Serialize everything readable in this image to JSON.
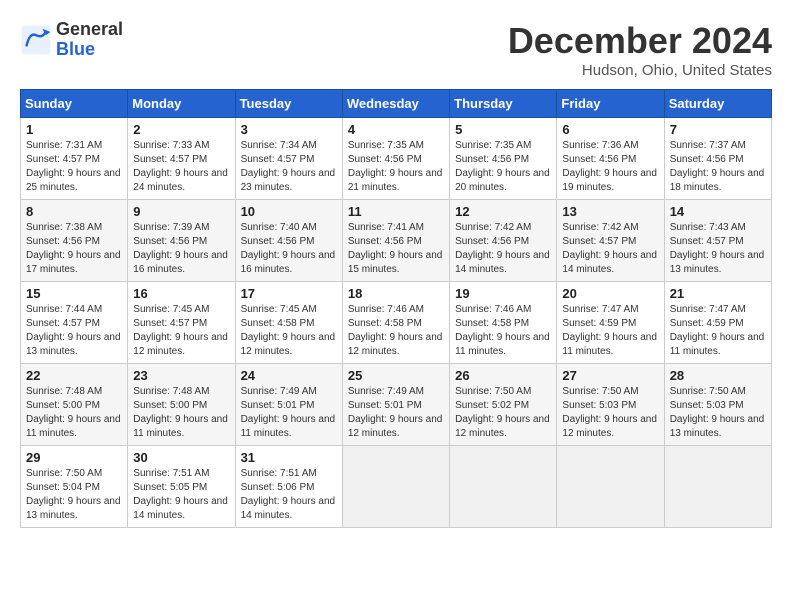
{
  "header": {
    "logo_line1": "General",
    "logo_line2": "Blue",
    "month_title": "December 2024",
    "location": "Hudson, Ohio, United States"
  },
  "days_of_week": [
    "Sunday",
    "Monday",
    "Tuesday",
    "Wednesday",
    "Thursday",
    "Friday",
    "Saturday"
  ],
  "weeks": [
    [
      {
        "num": "1",
        "sunrise": "Sunrise: 7:31 AM",
        "sunset": "Sunset: 4:57 PM",
        "daylight": "Daylight: 9 hours and 25 minutes."
      },
      {
        "num": "2",
        "sunrise": "Sunrise: 7:33 AM",
        "sunset": "Sunset: 4:57 PM",
        "daylight": "Daylight: 9 hours and 24 minutes."
      },
      {
        "num": "3",
        "sunrise": "Sunrise: 7:34 AM",
        "sunset": "Sunset: 4:57 PM",
        "daylight": "Daylight: 9 hours and 23 minutes."
      },
      {
        "num": "4",
        "sunrise": "Sunrise: 7:35 AM",
        "sunset": "Sunset: 4:56 PM",
        "daylight": "Daylight: 9 hours and 21 minutes."
      },
      {
        "num": "5",
        "sunrise": "Sunrise: 7:35 AM",
        "sunset": "Sunset: 4:56 PM",
        "daylight": "Daylight: 9 hours and 20 minutes."
      },
      {
        "num": "6",
        "sunrise": "Sunrise: 7:36 AM",
        "sunset": "Sunset: 4:56 PM",
        "daylight": "Daylight: 9 hours and 19 minutes."
      },
      {
        "num": "7",
        "sunrise": "Sunrise: 7:37 AM",
        "sunset": "Sunset: 4:56 PM",
        "daylight": "Daylight: 9 hours and 18 minutes."
      }
    ],
    [
      {
        "num": "8",
        "sunrise": "Sunrise: 7:38 AM",
        "sunset": "Sunset: 4:56 PM",
        "daylight": "Daylight: 9 hours and 17 minutes."
      },
      {
        "num": "9",
        "sunrise": "Sunrise: 7:39 AM",
        "sunset": "Sunset: 4:56 PM",
        "daylight": "Daylight: 9 hours and 16 minutes."
      },
      {
        "num": "10",
        "sunrise": "Sunrise: 7:40 AM",
        "sunset": "Sunset: 4:56 PM",
        "daylight": "Daylight: 9 hours and 16 minutes."
      },
      {
        "num": "11",
        "sunrise": "Sunrise: 7:41 AM",
        "sunset": "Sunset: 4:56 PM",
        "daylight": "Daylight: 9 hours and 15 minutes."
      },
      {
        "num": "12",
        "sunrise": "Sunrise: 7:42 AM",
        "sunset": "Sunset: 4:56 PM",
        "daylight": "Daylight: 9 hours and 14 minutes."
      },
      {
        "num": "13",
        "sunrise": "Sunrise: 7:42 AM",
        "sunset": "Sunset: 4:57 PM",
        "daylight": "Daylight: 9 hours and 14 minutes."
      },
      {
        "num": "14",
        "sunrise": "Sunrise: 7:43 AM",
        "sunset": "Sunset: 4:57 PM",
        "daylight": "Daylight: 9 hours and 13 minutes."
      }
    ],
    [
      {
        "num": "15",
        "sunrise": "Sunrise: 7:44 AM",
        "sunset": "Sunset: 4:57 PM",
        "daylight": "Daylight: 9 hours and 13 minutes."
      },
      {
        "num": "16",
        "sunrise": "Sunrise: 7:45 AM",
        "sunset": "Sunset: 4:57 PM",
        "daylight": "Daylight: 9 hours and 12 minutes."
      },
      {
        "num": "17",
        "sunrise": "Sunrise: 7:45 AM",
        "sunset": "Sunset: 4:58 PM",
        "daylight": "Daylight: 9 hours and 12 minutes."
      },
      {
        "num": "18",
        "sunrise": "Sunrise: 7:46 AM",
        "sunset": "Sunset: 4:58 PM",
        "daylight": "Daylight: 9 hours and 12 minutes."
      },
      {
        "num": "19",
        "sunrise": "Sunrise: 7:46 AM",
        "sunset": "Sunset: 4:58 PM",
        "daylight": "Daylight: 9 hours and 11 minutes."
      },
      {
        "num": "20",
        "sunrise": "Sunrise: 7:47 AM",
        "sunset": "Sunset: 4:59 PM",
        "daylight": "Daylight: 9 hours and 11 minutes."
      },
      {
        "num": "21",
        "sunrise": "Sunrise: 7:47 AM",
        "sunset": "Sunset: 4:59 PM",
        "daylight": "Daylight: 9 hours and 11 minutes."
      }
    ],
    [
      {
        "num": "22",
        "sunrise": "Sunrise: 7:48 AM",
        "sunset": "Sunset: 5:00 PM",
        "daylight": "Daylight: 9 hours and 11 minutes."
      },
      {
        "num": "23",
        "sunrise": "Sunrise: 7:48 AM",
        "sunset": "Sunset: 5:00 PM",
        "daylight": "Daylight: 9 hours and 11 minutes."
      },
      {
        "num": "24",
        "sunrise": "Sunrise: 7:49 AM",
        "sunset": "Sunset: 5:01 PM",
        "daylight": "Daylight: 9 hours and 11 minutes."
      },
      {
        "num": "25",
        "sunrise": "Sunrise: 7:49 AM",
        "sunset": "Sunset: 5:01 PM",
        "daylight": "Daylight: 9 hours and 12 minutes."
      },
      {
        "num": "26",
        "sunrise": "Sunrise: 7:50 AM",
        "sunset": "Sunset: 5:02 PM",
        "daylight": "Daylight: 9 hours and 12 minutes."
      },
      {
        "num": "27",
        "sunrise": "Sunrise: 7:50 AM",
        "sunset": "Sunset: 5:03 PM",
        "daylight": "Daylight: 9 hours and 12 minutes."
      },
      {
        "num": "28",
        "sunrise": "Sunrise: 7:50 AM",
        "sunset": "Sunset: 5:03 PM",
        "daylight": "Daylight: 9 hours and 13 minutes."
      }
    ],
    [
      {
        "num": "29",
        "sunrise": "Sunrise: 7:50 AM",
        "sunset": "Sunset: 5:04 PM",
        "daylight": "Daylight: 9 hours and 13 minutes."
      },
      {
        "num": "30",
        "sunrise": "Sunrise: 7:51 AM",
        "sunset": "Sunset: 5:05 PM",
        "daylight": "Daylight: 9 hours and 14 minutes."
      },
      {
        "num": "31",
        "sunrise": "Sunrise: 7:51 AM",
        "sunset": "Sunset: 5:06 PM",
        "daylight": "Daylight: 9 hours and 14 minutes."
      },
      null,
      null,
      null,
      null
    ]
  ]
}
